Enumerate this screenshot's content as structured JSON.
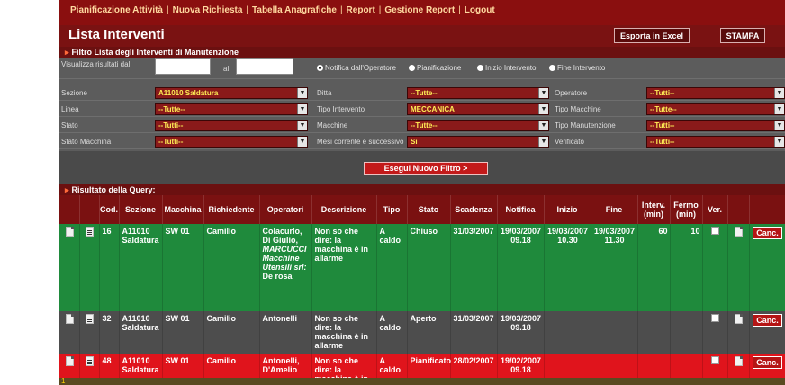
{
  "menu": {
    "items": [
      "Pianificazione Attività",
      "Nuova Richiesta",
      "Tabella Anagrafiche",
      "Report",
      "Gestione Report",
      "Logout"
    ],
    "separator": "|"
  },
  "header": {
    "title": "Lista Interventi",
    "export_label": "Esporta in Excel",
    "print_label": "STAMPA"
  },
  "filter": {
    "section_title": "Filtro Lista degli Interventi di Manutenzione",
    "view_from_label": "Visualizza risultati dal",
    "to_label": "al",
    "view_from_value": "",
    "to_value": "",
    "radios": [
      {
        "label": "Notifica dall'Operatore",
        "selected": true
      },
      {
        "label": "Pianificazione",
        "selected": false
      },
      {
        "label": "Inizio Intervento",
        "selected": false
      },
      {
        "label": "Fine Intervento",
        "selected": false
      }
    ],
    "rows": [
      [
        {
          "label": "Sezione",
          "value": "A11010 Saldatura"
        },
        {
          "label": "Ditta",
          "value": "--Tutte--"
        },
        {
          "label": "Operatore",
          "value": "--Tutti--"
        }
      ],
      [
        {
          "label": "Linea",
          "value": "--Tutte--"
        },
        {
          "label": "Tipo Intervento",
          "value": "MECCANICA"
        },
        {
          "label": "Tipo Macchine",
          "value": "--Tutte--"
        }
      ],
      [
        {
          "label": "Stato",
          "value": "--Tutti--"
        },
        {
          "label": "Macchine",
          "value": "--Tutte--"
        },
        {
          "label": "Tipo Manutenzione",
          "value": "--Tutti--"
        }
      ],
      [
        {
          "label": "Stato Macchina",
          "value": "--Tutti--"
        },
        {
          "label": "Mesi corrente e successivo",
          "value": "Si"
        },
        {
          "label": "Verificato",
          "value": "--Tutti--"
        }
      ]
    ],
    "run_button": "Esegui Nuovo Filtro >"
  },
  "results": {
    "section_title": "Risultato della Query:",
    "columns": [
      "",
      "",
      "Cod.",
      "Sezione",
      "Macchina",
      "Richiedente",
      "Operatori",
      "Descrizione",
      "Tipo",
      "Stato",
      "Scadenza",
      "Notifica",
      "Inizio",
      "Fine",
      "Interv. (min)",
      "Fermo (min)",
      "Ver.",
      "",
      ""
    ],
    "cancel_label": "Canc.",
    "rows": [
      {
        "style": "green",
        "cod": "16",
        "sezione": "A11010 Saldatura",
        "macchina": "SW 01",
        "richiedente": "Camilio",
        "operatori": "Colacurlo, Di Giulio,",
        "operatori_italic": "MARCUCCI Macchine Utensili srl:",
        "operatori_tail": "De rosa",
        "descrizione": "Non so che dire: la macchina è in allarme",
        "tipo": "A caldo",
        "stato": "Chiuso",
        "scadenza": "31/03/2007",
        "notifica": "19/03/2007 09.18",
        "inizio": "19/03/2007 10.30",
        "fine": "19/03/2007 11.30",
        "interv": "60",
        "fermo": "10"
      },
      {
        "style": "gray",
        "cod": "32",
        "sezione": "A11010 Saldatura",
        "macchina": "SW 01",
        "richiedente": "Camilio",
        "operatori": "Antonelli",
        "operatori_italic": "",
        "operatori_tail": "",
        "descrizione": "Non so che dire: la macchina è in allarme",
        "tipo": "A caldo",
        "stato": "Aperto",
        "scadenza": "31/03/2007",
        "notifica": "19/03/2007 09.18",
        "inizio": "",
        "fine": "",
        "interv": "",
        "fermo": ""
      },
      {
        "style": "red",
        "cod": "48",
        "sezione": "A11010 Saldatura",
        "macchina": "SW 01",
        "richiedente": "Camilio",
        "operatori": "Antonelli, D'Amelio",
        "operatori_italic": "",
        "operatori_tail": "",
        "descrizione": "Non so che dire: la macchina è in allarme",
        "tipo": "A caldo",
        "stato": "Pianificato",
        "scadenza": "28/02/2007",
        "notifica": "19/02/2007 09.18",
        "inizio": "",
        "fine": "",
        "interv": "",
        "fermo": ""
      }
    ]
  },
  "footer": {
    "page": "1"
  },
  "colors": {
    "brand": "#7a1212",
    "green_row": "#1f8a3c",
    "gray_row": "#4d4d4d",
    "red_row": "#e0141c",
    "select_text": "#ffee55"
  }
}
